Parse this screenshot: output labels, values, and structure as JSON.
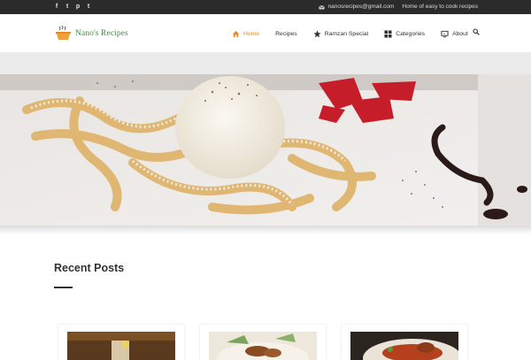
{
  "topbar": {
    "social": [
      "f",
      "t",
      "p",
      "t"
    ],
    "email": "nanosrecipes@gmail.com",
    "tagline": "Home of easy to cook recipes"
  },
  "brand": {
    "name": "Nano's Recipes"
  },
  "nav": {
    "items": [
      {
        "label": "Home",
        "icon": "home-icon"
      },
      {
        "label": "Recipes"
      },
      {
        "label": "Ramzan Special",
        "icon": "star-icon"
      },
      {
        "label": "Categories",
        "icon": "grid-icon"
      },
      {
        "label": "About",
        "icon": "monitor-icon"
      }
    ]
  },
  "colors": {
    "accent": "#e7892b",
    "topbar": "#2b2b2b",
    "logo": "#3b8f3b"
  },
  "recent": {
    "title": "Recent Posts"
  }
}
